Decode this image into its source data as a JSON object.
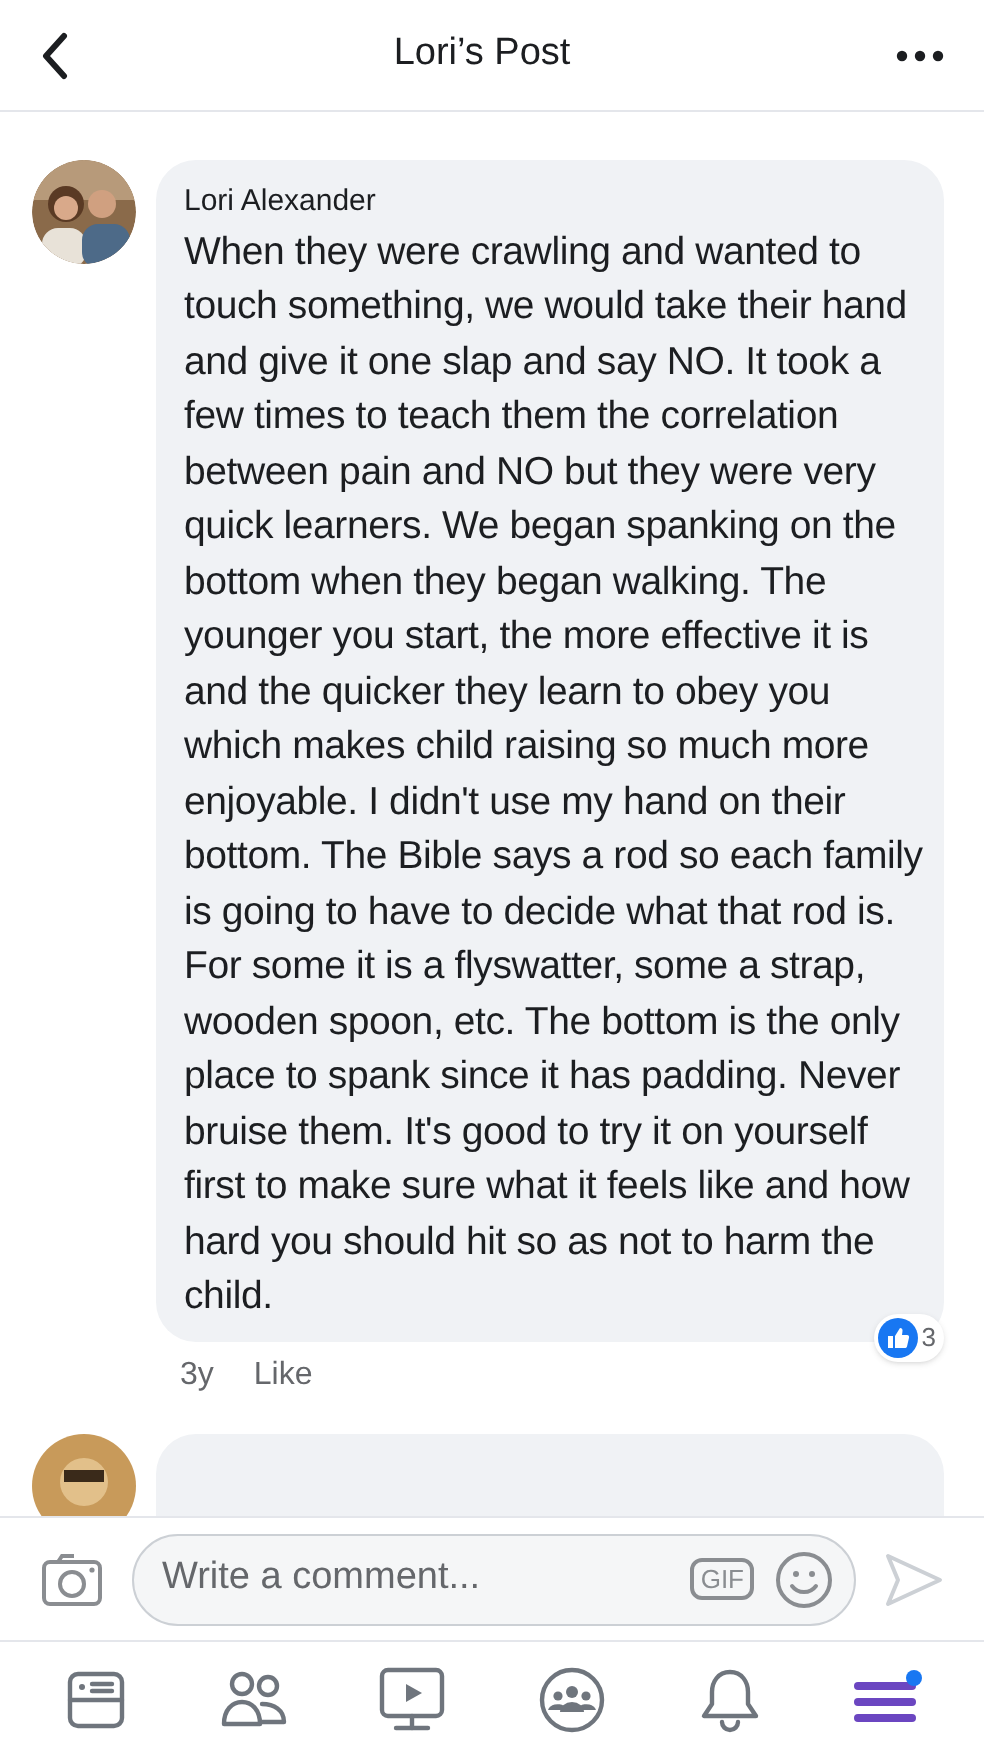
{
  "header": {
    "title": "Lori’s Post"
  },
  "comments": [
    {
      "author": "Lori Alexander",
      "text": "When they were crawling and wanted to touch something, we would take their hand and give it one slap and say NO. It took a few times to teach them the correlation between pain and NO but they were very quick learners. We began spanking on the bottom when they began walking. The younger you start, the more effective it is and the quicker they learn to obey you which makes child raising so much more enjoyable. I didn't use my hand on their bottom. The Bible says a rod so each family is going to have to decide what that rod is. For some it is a flyswatter, some a strap, wooden spoon, etc. The bottom is the only place to spank since it has padding. Never bruise them. It's good to try it on yourself first to make sure what it feels like and how hard you should hit so as not to harm the child.",
      "time": "3y",
      "like": "Like",
      "reactions": "3"
    }
  ],
  "composer": {
    "placeholder": "Write a comment...",
    "gif_label": "GIF"
  },
  "tabs": [
    {
      "kind": "feed",
      "selected": false
    },
    {
      "kind": "friends",
      "selected": false
    },
    {
      "kind": "watch",
      "selected": false
    },
    {
      "kind": "groups",
      "selected": false
    },
    {
      "kind": "notifications",
      "selected": false
    },
    {
      "kind": "menu",
      "selected": true
    }
  ]
}
